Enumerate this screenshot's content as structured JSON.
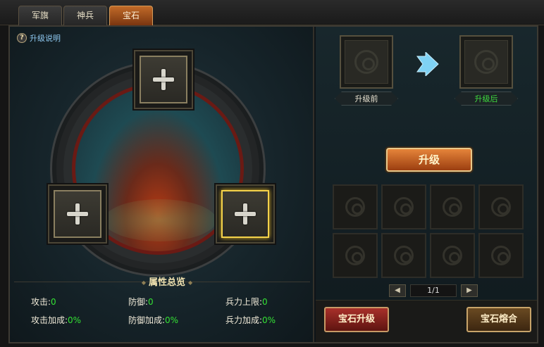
{
  "tabs": [
    {
      "label": "军旗",
      "active": false
    },
    {
      "label": "神兵",
      "active": false
    },
    {
      "label": "宝石",
      "active": true
    }
  ],
  "left_panel": {
    "help_icon_text": "?",
    "help_link": "升级说明",
    "slots": [
      {
        "name": "top",
        "selected": false
      },
      {
        "name": "left",
        "selected": false
      },
      {
        "name": "right",
        "selected": true
      }
    ],
    "attributes_title": "属性总览",
    "attributes": [
      {
        "label": "攻击:",
        "value": "0"
      },
      {
        "label": "防御:",
        "value": "0"
      },
      {
        "label": "兵力上限:",
        "value": "0"
      },
      {
        "label": "攻击加成:",
        "value": "0%"
      },
      {
        "label": "防御加成:",
        "value": "0%"
      },
      {
        "label": "兵力加成:",
        "value": "0%"
      }
    ],
    "value_color": "#34e234"
  },
  "right_panel": {
    "before_label": "升级前",
    "after_label": "升级后",
    "after_label_color": "#3fdc3f",
    "upgrade_button": "升级",
    "grid_cells": 8,
    "pager": {
      "prev": "◀",
      "text": "1/1",
      "next": "▶"
    },
    "gem_upgrade_button": "宝石升级",
    "gem_fuse_button": "宝石熔合"
  }
}
